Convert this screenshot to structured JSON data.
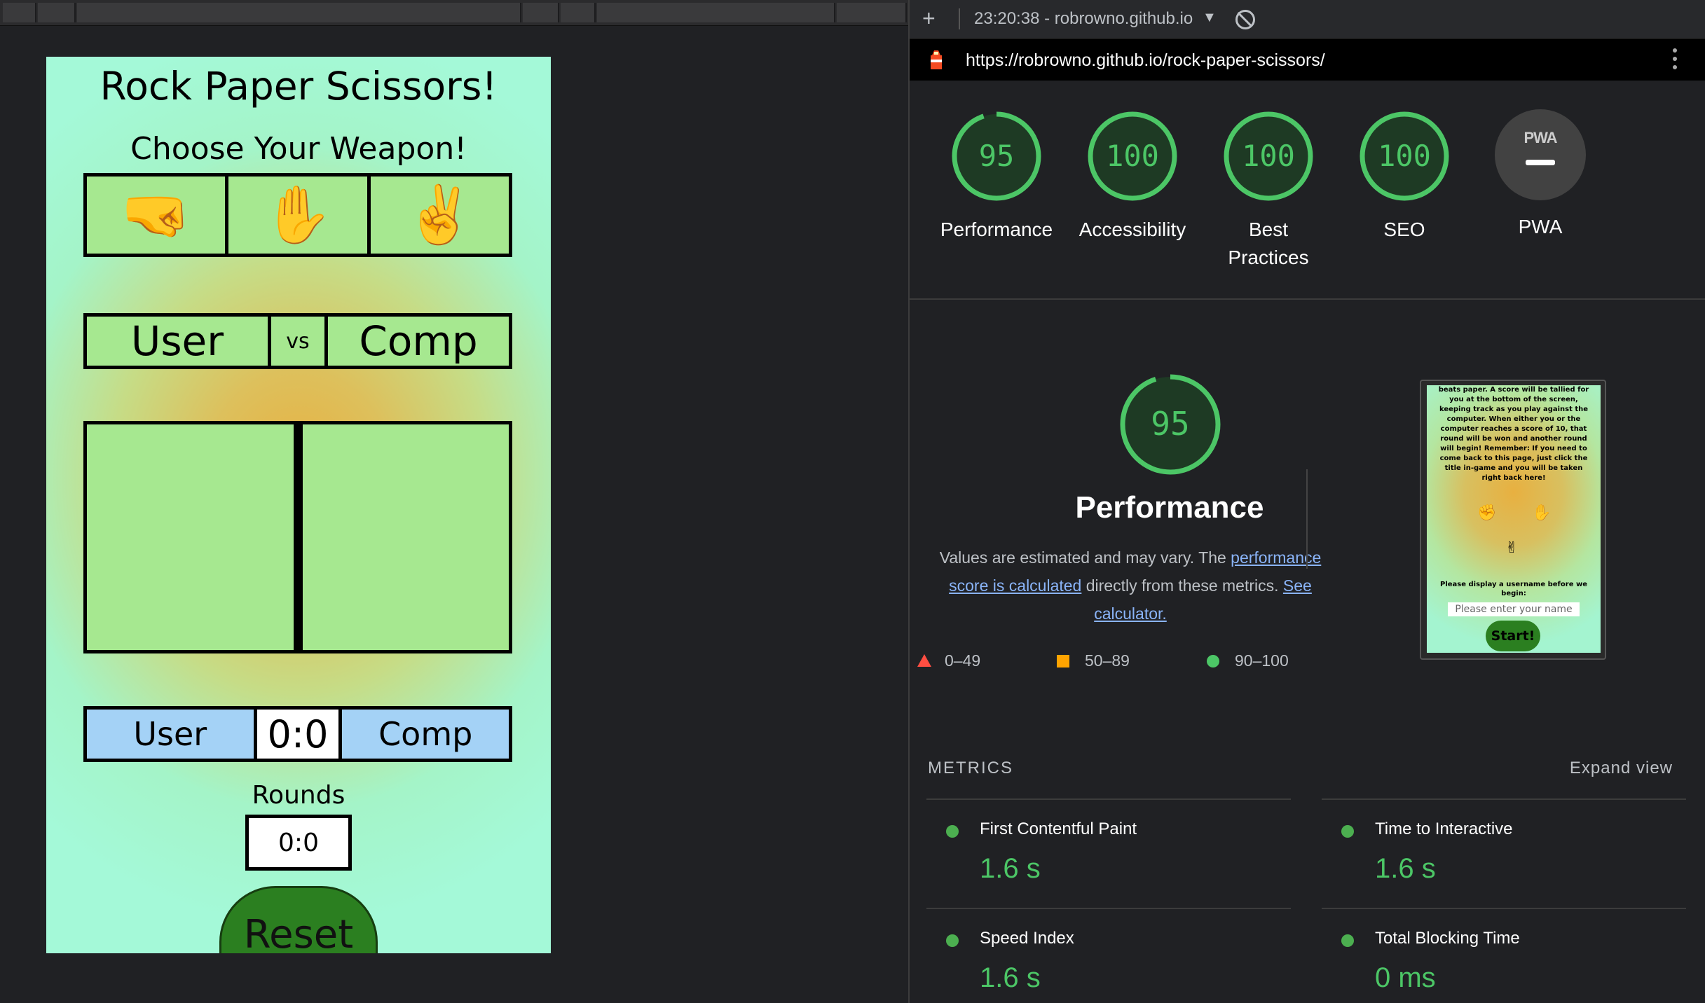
{
  "game": {
    "title": "Rock Paper Scissors!",
    "subtitle": "Choose Your Weapon!",
    "weapons": [
      "🤜",
      "✋",
      "✌️"
    ],
    "vs_user": "User",
    "vs_label": "vs",
    "vs_comp": "Comp",
    "score_user": "User",
    "score_value": "0:0",
    "score_comp": "Comp",
    "rounds_label": "Rounds",
    "rounds_value": "0:0",
    "reset_label": "Reset"
  },
  "lighthouse": {
    "add": "+",
    "run_label": "23:20:38 - robrowno.github.io",
    "url": "https://robrowno.github.io/rock-paper-scissors/",
    "colors": {
      "pass": "#4cc666",
      "average": "#ffa400",
      "fail": "#ff4e42"
    },
    "gauges": [
      {
        "score": 95,
        "label": "Performance"
      },
      {
        "score": 100,
        "label": "Accessibility"
      },
      {
        "score": 100,
        "label": "Best Practices"
      },
      {
        "score": 100,
        "label": "SEO"
      }
    ],
    "pwa": {
      "badge": "PWA",
      "label": "PWA"
    },
    "performance": {
      "score": 95,
      "title": "Performance",
      "desc_1": "Values are estimated and may vary. The",
      "link_1": "performance score is calculated",
      "desc_2": "directly from these metrics.",
      "link_2": "See calculator.",
      "legend": [
        {
          "icon": "red-triangle-icon",
          "range": "0–49"
        },
        {
          "icon": "orange-square-icon",
          "range": "50–89"
        },
        {
          "icon": "green-circle-icon",
          "range": "90–100"
        }
      ]
    },
    "screenshot": {
      "text": "beats paper. A score will be tallied for you at the bottom of the screen, keeping track as you play against the computer. When either you or the computer reaches a score of 10, that round will be won and another round will begin! Remember: If you need to come back to this page, just click the title in-game and you will be taken right back here!",
      "prompt": "Please display a username before we begin:",
      "input_placeholder": "Please enter your name",
      "start_label": "Start!"
    },
    "metrics_title": "METRICS",
    "expand_label": "Expand view",
    "metrics": [
      {
        "name": "First Contentful Paint",
        "value": "1.6 s"
      },
      {
        "name": "Time to Interactive",
        "value": "1.6 s"
      },
      {
        "name": "Speed Index",
        "value": "1.6 s"
      },
      {
        "name": "Total Blocking Time",
        "value": "0 ms"
      }
    ]
  }
}
